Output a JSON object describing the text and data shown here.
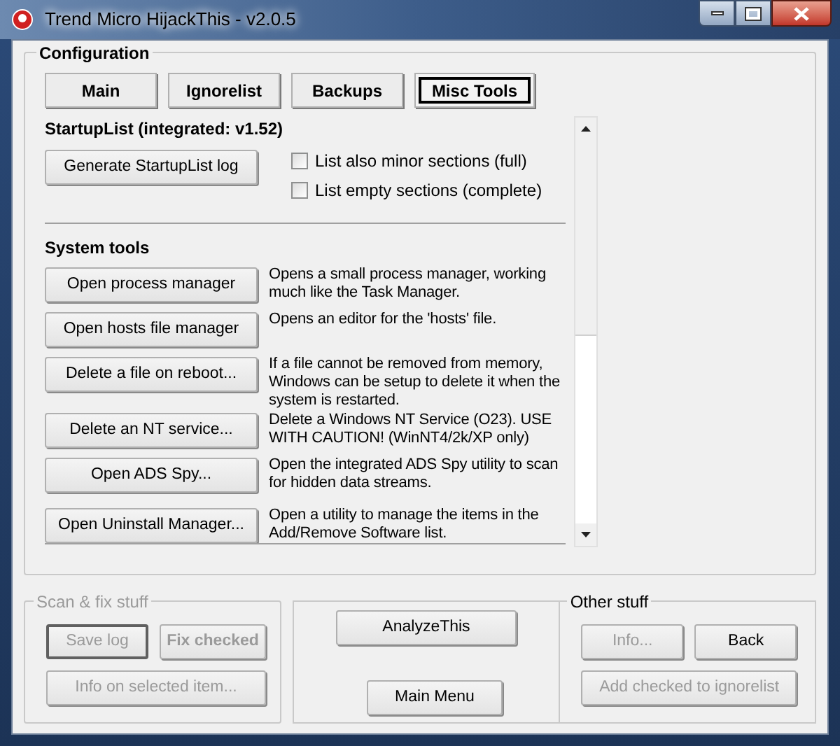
{
  "window": {
    "title": "Trend Micro HijackThis - v2.0.5"
  },
  "configuration": {
    "title": "Configuration",
    "tabs": [
      {
        "label": "Main",
        "selected": false
      },
      {
        "label": "Ignorelist",
        "selected": false
      },
      {
        "label": "Backups",
        "selected": false
      },
      {
        "label": "Misc Tools",
        "selected": true
      }
    ],
    "startuplist": {
      "heading": "StartupList (integrated: v1.52)",
      "button": "Generate StartupList log",
      "options": [
        {
          "label": "List also minor sections (full)",
          "checked": false
        },
        {
          "label": "List empty sections (complete)",
          "checked": false
        }
      ]
    },
    "system_tools": {
      "heading": "System tools",
      "tools": [
        {
          "button": "Open process manager",
          "description": "Opens a small process manager, working much like the Task Manager."
        },
        {
          "button": "Open hosts file manager",
          "description": "Opens an editor for the 'hosts' file."
        },
        {
          "button": "Delete a file on reboot...",
          "description": "If a file cannot be removed from memory, Windows can be setup to delete it when the system is restarted."
        },
        {
          "button": "Delete an NT service...",
          "description": "Delete a Windows NT Service (O23). USE WITH CAUTION! (WinNT4/2k/XP only)"
        },
        {
          "button": "Open ADS Spy...",
          "description": "Open the integrated ADS Spy utility to scan for hidden data streams."
        },
        {
          "button": "Open Uninstall Manager...",
          "description": "Open a utility to manage the items in the Add/Remove Software list."
        }
      ]
    }
  },
  "scan_fix": {
    "title": "Scan & fix stuff",
    "disabled": true,
    "buttons": [
      {
        "label": "Save log",
        "disabled": true,
        "default": true,
        "bold": false
      },
      {
        "label": "Fix checked",
        "disabled": true,
        "default": false,
        "bold": true
      },
      {
        "label": "Info on selected item...",
        "disabled": true,
        "default": false,
        "bold": false
      }
    ]
  },
  "center": {
    "buttons": [
      {
        "label": "AnalyzeThis",
        "disabled": false
      },
      {
        "label": "Main Menu",
        "disabled": false
      }
    ]
  },
  "other_stuff": {
    "title": "Other stuff",
    "buttons": [
      {
        "label": "Info...",
        "disabled": true
      },
      {
        "label": "Back",
        "disabled": false
      },
      {
        "label": "Add checked to ignorelist",
        "disabled": true
      }
    ]
  }
}
